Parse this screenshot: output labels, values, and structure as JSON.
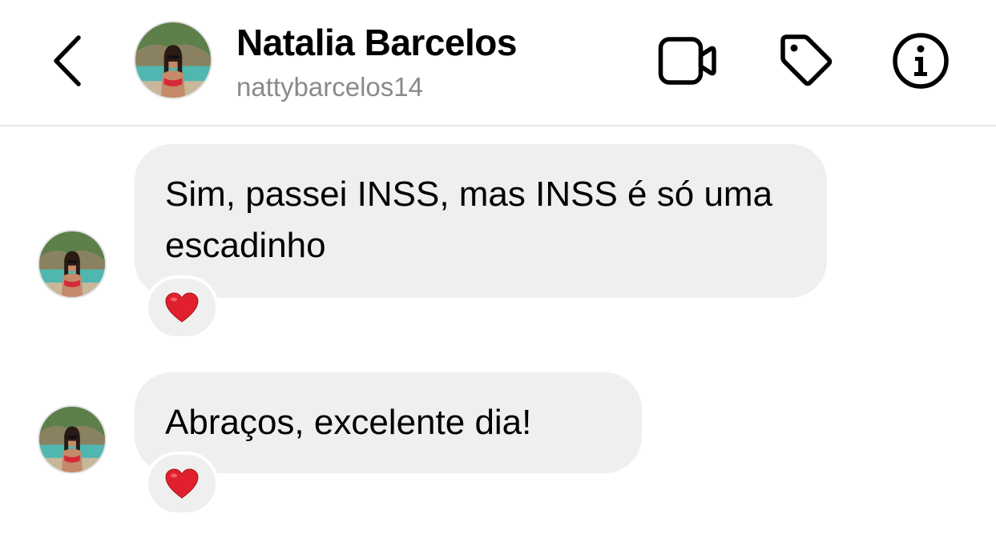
{
  "header": {
    "contact_name": "Natalia Barcelos",
    "contact_username": "nattybarcelos14",
    "icons": [
      "chevron-left-icon",
      "video-camera-icon",
      "tag-icon",
      "info-icon"
    ]
  },
  "messages": [
    {
      "text": "Sim, passei INSS, mas INSS é só uma escadinho",
      "reaction": "heart"
    },
    {
      "text": "Abraços, excelente dia!",
      "reaction": "heart"
    }
  ],
  "colors": {
    "bubble_background": "#efefef",
    "reaction_heart": "#e0202e",
    "username_text": "#8a8a8a",
    "divider": "#e4e4e4"
  }
}
